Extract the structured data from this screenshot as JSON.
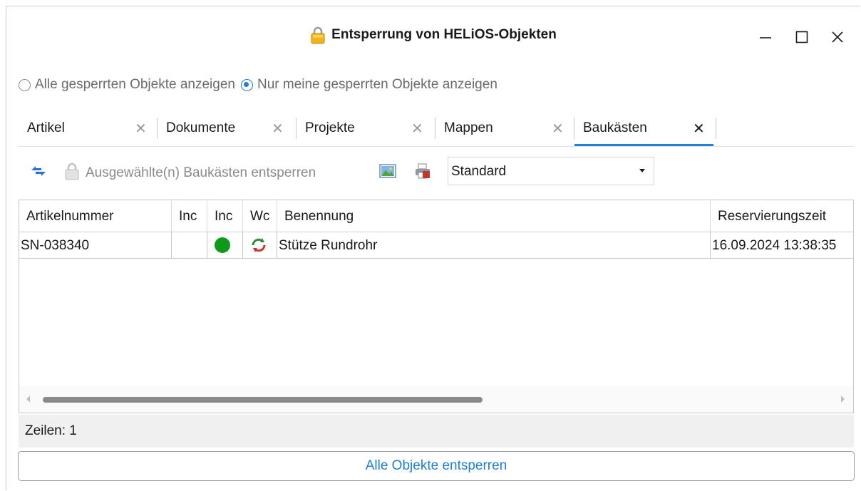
{
  "window": {
    "title": "Entsperrung von HELiOS-Objekten",
    "title_icon": "lock-icon",
    "controls": [
      "minimize",
      "maximize",
      "close"
    ]
  },
  "filter": {
    "option_all": "Alle gesperrten Objekte anzeigen",
    "option_mine": "Nur meine gesperrten Objekte anzeigen",
    "selected": "option_mine"
  },
  "tabs": [
    {
      "label": "Artikel"
    },
    {
      "label": "Dokumente"
    },
    {
      "label": "Projekte"
    },
    {
      "label": "Mappen"
    },
    {
      "label": "Baukästen",
      "active": true
    }
  ],
  "toolbar": {
    "unlock_selected_label": "Ausgewählte(n) Baukästen entsperren",
    "view_select_value": "Standard"
  },
  "table": {
    "headers": [
      "Artikelnummer",
      "Inc",
      "Inc",
      "Wc",
      "Benennung",
      "Reservierungszeit"
    ],
    "rows": [
      {
        "artikelnummer": "SN-038340",
        "inc1": "",
        "status": "green-dot",
        "workflow": "refresh-icon",
        "benennung": "Stütze Rundrohr",
        "reservierungszeit": "16.09.2024 13:38:35"
      }
    ]
  },
  "status": {
    "rows_label": "Zeilen: 1"
  },
  "footer": {
    "unlock_all_label": "Alle Objekte entsperren"
  },
  "colors": {
    "accent": "#1e7fd8",
    "status_green": "#0d9a1a"
  }
}
